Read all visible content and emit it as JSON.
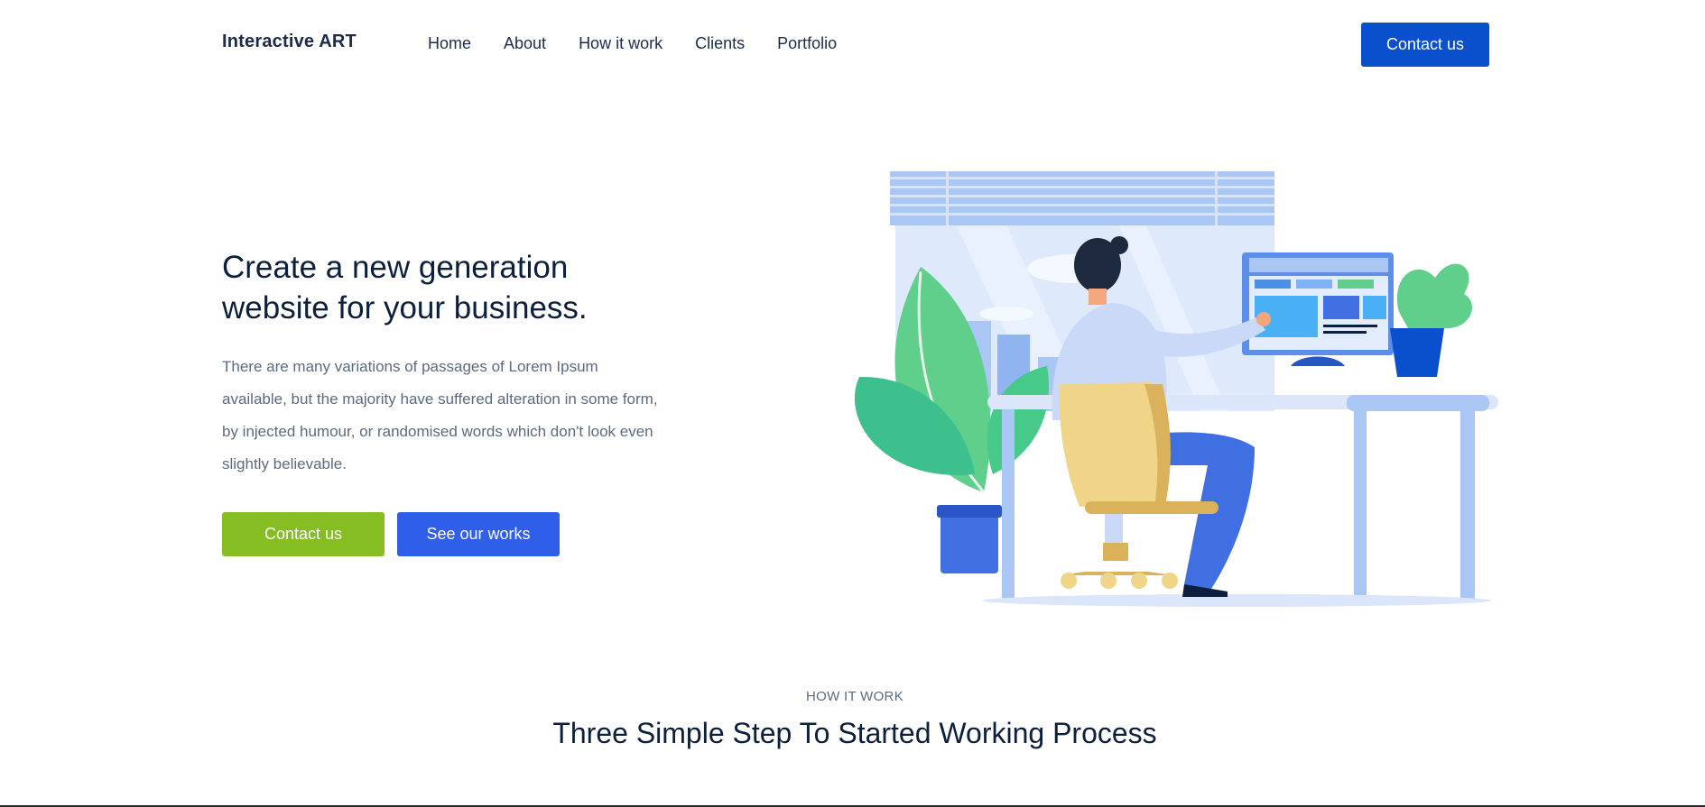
{
  "header": {
    "brand": "Interactive ART",
    "nav": [
      "Home",
      "About",
      "How it work",
      "Clients",
      "Portfolio"
    ],
    "cta_label": "Contact us"
  },
  "hero": {
    "title_line1": "Create a new generation",
    "title_line2": "website for your business.",
    "description": "There are many variations of passages of Lorem Ipsum available, but the majority have suffered alteration in some form, by injected humour, or randomised words which don't look even slightly believable.",
    "primary_button": "Contact us",
    "secondary_button": "See our works"
  },
  "how_it_works": {
    "eyebrow": "HOW IT WORK",
    "title": "Three Simple Step To Started Working Process"
  },
  "colors": {
    "brand_blue": "#0a4fcc",
    "button_green": "#85bd23",
    "button_blue": "#2f5fe8",
    "heading": "#0c1f3d",
    "body_text": "#5c6a80"
  }
}
